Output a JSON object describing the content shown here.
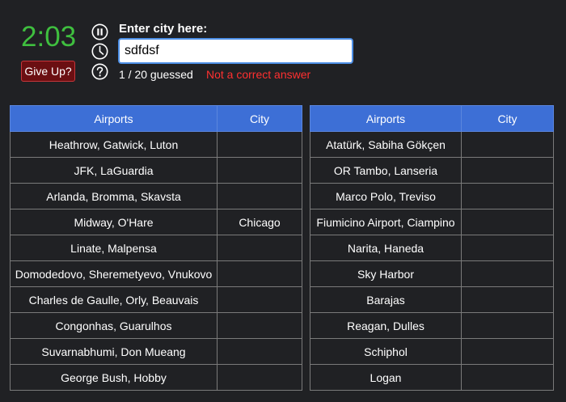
{
  "timer": "2:03",
  "give_up_label": "Give Up?",
  "prompt_label": "Enter city here:",
  "input_value": "sdfdsf",
  "progress_text": "1 / 20 guessed",
  "feedback_text": "Not a correct answer",
  "colors": {
    "timer": "#3fbf3f",
    "correct_answer": "#3fbf3f",
    "feedback_error": "#ff3030",
    "header_bg": "#3d6fd6",
    "page_bg": "#202124"
  },
  "icons": [
    "pause-icon",
    "clock-icon",
    "help-icon"
  ],
  "headers": {
    "airports": "Airports",
    "city": "City"
  },
  "left_table": [
    {
      "airports": "Heathrow, Gatwick, Luton",
      "city": ""
    },
    {
      "airports": "JFK, LaGuardia",
      "city": ""
    },
    {
      "airports": "Arlanda, Bromma, Skavsta",
      "city": ""
    },
    {
      "airports": "Midway, O'Hare",
      "city": "Chicago"
    },
    {
      "airports": "Linate, Malpensa",
      "city": ""
    },
    {
      "airports": "Domodedovo, Sheremetyevo, Vnukovo",
      "city": ""
    },
    {
      "airports": "Charles de Gaulle, Orly, Beauvais",
      "city": ""
    },
    {
      "airports": "Congonhas, Guarulhos",
      "city": ""
    },
    {
      "airports": "Suvarnabhumi, Don Mueang",
      "city": ""
    },
    {
      "airports": "George Bush, Hobby",
      "city": ""
    }
  ],
  "right_table": [
    {
      "airports": "Atatürk, Sabiha Gökçen",
      "city": ""
    },
    {
      "airports": "OR Tambo, Lanseria",
      "city": ""
    },
    {
      "airports": "Marco Polo, Treviso",
      "city": ""
    },
    {
      "airports": "Fiumicino Airport, Ciampino",
      "city": ""
    },
    {
      "airports": "Narita, Haneda",
      "city": ""
    },
    {
      "airports": "Sky Harbor",
      "city": ""
    },
    {
      "airports": "Barajas",
      "city": ""
    },
    {
      "airports": "Reagan, Dulles",
      "city": ""
    },
    {
      "airports": "Schiphol",
      "city": ""
    },
    {
      "airports": "Logan",
      "city": ""
    }
  ]
}
